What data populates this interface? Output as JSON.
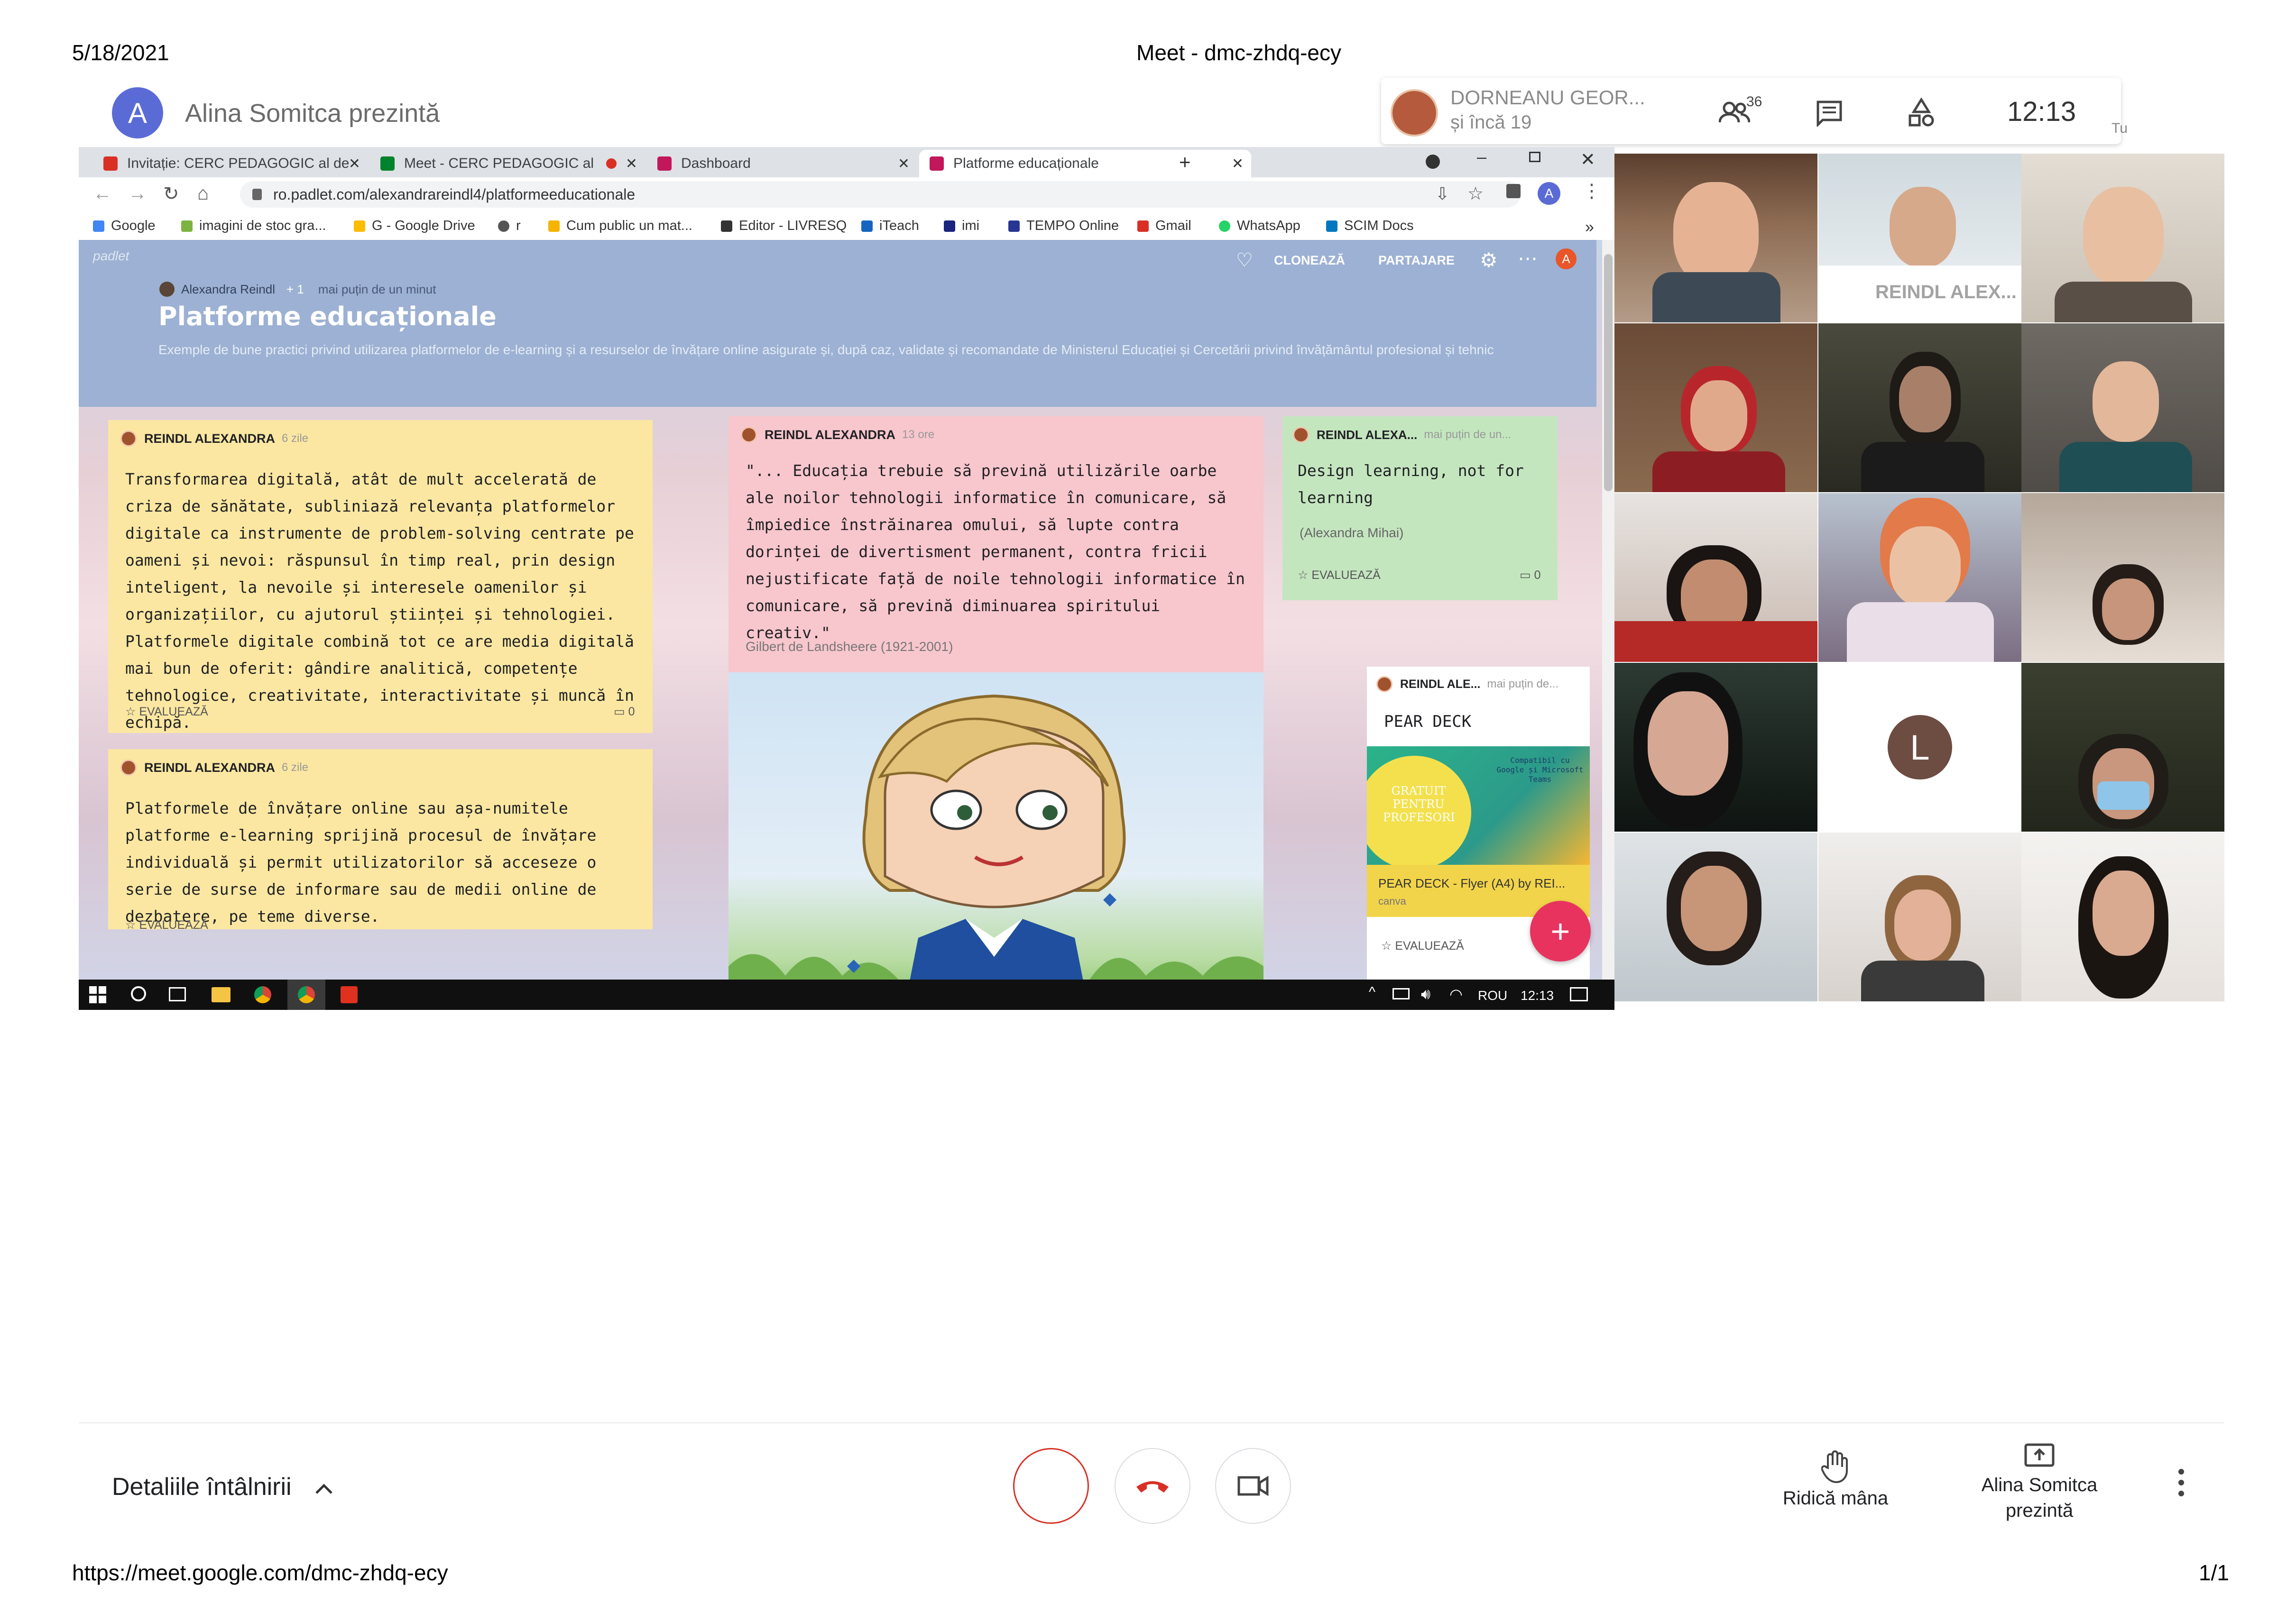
{
  "print_header": {
    "date": "5/18/2021",
    "title": "Meet - dmc-zhdq-ecy"
  },
  "print_footer": {
    "url": "https://meet.google.com/dmc-zhdq-ecy",
    "page": "1/1"
  },
  "meet_header": {
    "presenter_initial": "A",
    "presenting_text": "Alina Somitca prezintă",
    "participant_name": "DORNEANU GEOR...",
    "participant_more": "și încă 19",
    "people_count": "36",
    "clock": "12:13",
    "self_label": "Tu"
  },
  "browser": {
    "tabs": [
      {
        "label": "Invitație: CERC PEDAGOGIC al de",
        "favicon_color": "#d93025"
      },
      {
        "label": "Meet - CERC PEDAGOGIC al",
        "favicon_color": "#00832d"
      },
      {
        "label": "Dashboard",
        "favicon_color": "#c2185b"
      },
      {
        "label": "Platforme educaționale",
        "favicon_color": "#c2185b"
      }
    ],
    "new_tab": "+",
    "url": "ro.padlet.com/alexandrareindl4/platformeeducationale",
    "profile_initial": "A",
    "bookmarks": [
      {
        "label": "Google",
        "color": "#4285f4"
      },
      {
        "label": "imagini de stoc gra...",
        "color": "#7cb342"
      },
      {
        "label": "G - Google Drive",
        "color": "#fbbc04"
      },
      {
        "label": "r",
        "color": "#555555"
      },
      {
        "label": "Cum public un mat...",
        "color": "#f4b400"
      },
      {
        "label": "Editor - LIVRESQ",
        "color": "#333333"
      },
      {
        "label": "iTeach",
        "color": "#1565c0"
      },
      {
        "label": "imi",
        "color": "#1a237e"
      },
      {
        "label": "TEMPO Online",
        "color": "#283593"
      },
      {
        "label": "Gmail",
        "color": "#d93025"
      },
      {
        "label": "WhatsApp",
        "color": "#25d366"
      },
      {
        "label": "SCIM Docs",
        "color": "#0277bd"
      }
    ],
    "more_bookmarks": "»"
  },
  "padlet": {
    "logo": "padlet",
    "author": "Alexandra Reindl",
    "plus": "+ 1",
    "time": "mai puțin de un minut",
    "title": "Platforme educaționale",
    "description": "Exemple de bune practici privind utilizarea platformelor de e-learning și a resurselor de învățare online asigurate și, după caz, validate și recomandate de Ministerul Educației și Cercetării privind învățământul profesional și tehnic",
    "actions": {
      "clone": "CLONEAZĂ",
      "share": "PARTAJARE",
      "user_initial": "A"
    },
    "cards": {
      "c1": {
        "author": "REINDL ALEXANDRA",
        "time": "6 zile",
        "text": "Transformarea digitală, atât de mult accelerată de criza de sănătate, subliniază relevanța platformelor digitale ca instrumente de problem-solving centrate pe oameni și nevoi: răspunsul în timp real, prin design inteligent, la nevoile și interesele oamenilor și organizațiilor, cu ajutorul științei și tehnologiei. Platformele digitale combină tot ce are media digitală mai bun de oferit: gândire analitică, competențe tehnologice, creativitate, interactivitate și muncă în echipă.",
        "rate": "EVALUEAZĂ",
        "comments": "0"
      },
      "c2": {
        "author": "REINDL ALEXANDRA",
        "time": "6 zile",
        "text": "Platformele de învățare online sau așa-numitele platforme e-learning sprijină procesul de învățare individuală și permit utilizatorilor să acceseze o serie de surse de informare sau de medii online de dezbatere, pe teme diverse.",
        "rate": "EVALUEAZĂ"
      },
      "c3": {
        "author": "REINDL ALEXANDRA",
        "time": "13 ore",
        "text": "\"... Educația trebuie să prevină utilizările oarbe ale noilor tehnologii informatice în comunicare, să împiedice înstrăinarea omului, să lupte contra dorinței de divertisment permanent, contra fricii nejustificate față de noile tehnologii informatice în comunicare, să prevină diminuarea spiritului creativ.\"",
        "source": "Gilbert de Landsheere (1921-2001)"
      },
      "c4": {
        "author": "REINDL ALEXA...",
        "time": "mai puțin de un...",
        "text": "Design learning, not for learning",
        "source": "(Alexandra Mihai)",
        "rate": "EVALUEAZĂ",
        "comments": "0"
      },
      "c5": {
        "author": "REINDL ALE...",
        "time": "mai puțin de...",
        "title": "PEAR DECK",
        "thumb_text": "GRATUIT PENTRU PROFESORI",
        "thumb_small": "Compatibil cu Google și Microsoft Teams",
        "file": "PEAR DECK - Flyer (A4) by REI...",
        "site": "canva",
        "rate": "EVALUEAZĂ"
      }
    },
    "add_button": "+"
  },
  "taskbar": {
    "lang": "ROU",
    "time": "12:13"
  },
  "grid": {
    "name_tile": "REINDL ALEX...",
    "initial_tile": "L"
  },
  "bottom_bar": {
    "meeting_details": "Detaliile întâlnirii",
    "raise_hand": "Ridică mâna",
    "presenting_line1": "Alina Somitca",
    "presenting_line2": "prezintă"
  }
}
